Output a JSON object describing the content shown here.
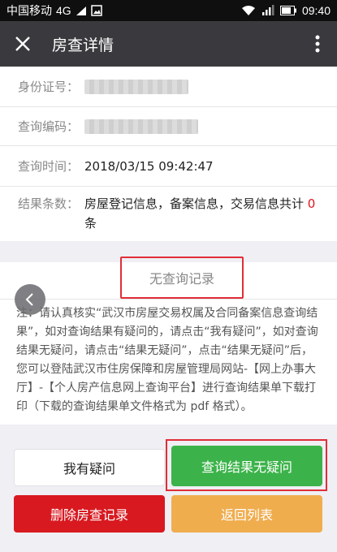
{
  "status_bar": {
    "carrier": "中国移动",
    "network": "4G",
    "time": "09:40"
  },
  "nav": {
    "title": "房查详情"
  },
  "info": {
    "id_label": "身份证号：",
    "code_label": "查询编码：",
    "time_label": "查询时间：",
    "time_value": "2018/03/15 09:42:47",
    "result_label": "结果条数：",
    "result_text": "房屋登记信息，备案信息，交易信息共计",
    "result_count": "0",
    "result_unit": "条"
  },
  "result": {
    "no_record": "无查询记录",
    "note": "注：请认真核实“武汉市房屋交易权属及合同备案信息查询结果”，如对查询结果有疑问的，请点击“我有疑问”，如对查询结果无疑问，请点击“结果无疑问”，点击“结果无疑问”后，您可以登陆武汉市住房保障和房屋管理局网站-【网上办事大厅】-【个人房产信息网上查询平台】进行查询结果单下载打印（下载的查询结果单文件格式为 pdf 格式）。"
  },
  "buttons": {
    "question": "我有疑问",
    "no_question": "查询结果无疑问",
    "delete": "删除房查记录",
    "back": "返回列表"
  },
  "colors": {
    "nav_bg": "#3a3a3e",
    "highlight": "#e02e38",
    "green": "#3cb34a",
    "red": "#d81920",
    "orange": "#f0ad4e"
  }
}
